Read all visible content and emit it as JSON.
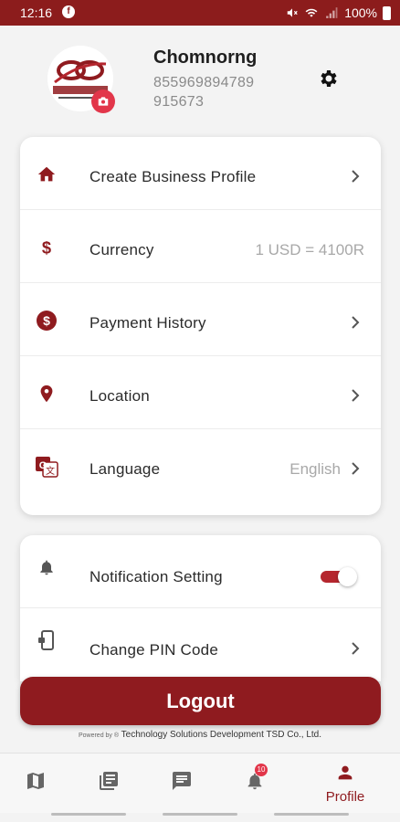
{
  "status_bar": {
    "time": "12:16",
    "battery": "100%"
  },
  "profile": {
    "name": "Chomnorng",
    "phone": "855969894789 915673",
    "avatar_text": "ចំណងឆ្លៀង",
    "avatar_subtext": "CHOMNORNG DELIVERY"
  },
  "menu": {
    "items": [
      {
        "label": "Create Business Profile",
        "value": "",
        "icon": "home-icon"
      },
      {
        "label": "Currency",
        "value": "1 USD = 4100R",
        "icon": "dollar-icon"
      },
      {
        "label": "Payment History",
        "value": "",
        "icon": "dollar-circle-icon"
      },
      {
        "label": "Location",
        "value": "",
        "icon": "location-pin-icon"
      },
      {
        "label": "Language",
        "value": "English",
        "icon": "translate-icon"
      }
    ]
  },
  "settings": {
    "items": [
      {
        "label": "Notification Setting",
        "icon": "bell-icon",
        "toggle": true
      },
      {
        "label": "Change PIN Code",
        "icon": "phone-lock-icon"
      }
    ]
  },
  "logout": {
    "label": "Logout"
  },
  "footer": {
    "powered_prefix": "Powered by ®",
    "company": "Technology Solutions Development TSD Co., Ltd."
  },
  "bottom_nav": {
    "items": [
      {
        "icon": "map-icon"
      },
      {
        "icon": "library-icon"
      },
      {
        "icon": "chat-icon"
      },
      {
        "icon": "notifications-icon",
        "badge": "10"
      },
      {
        "icon": "person-icon",
        "label": "Profile",
        "active": true
      }
    ]
  },
  "colors": {
    "brand": "#8f1b1f",
    "accent": "#e2364a",
    "background": "#f3f3f3"
  }
}
